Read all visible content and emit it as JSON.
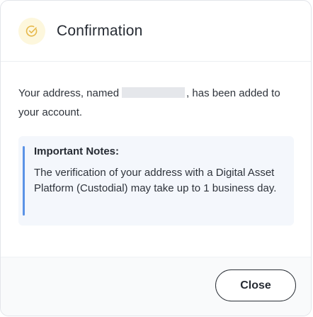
{
  "dialog": {
    "title": "Confirmation",
    "title_icon": "check-circle-icon",
    "accent_color": "#f2c94c"
  },
  "message": {
    "prefix": "Your address, named",
    "address_name_redacted": true,
    "suffix": ", has been added to your account."
  },
  "notes": {
    "title": "Important Notes:",
    "text": "The verification of your address with a Digital Asset Platform (Custodial) may take up to 1 business day.",
    "bar_color": "#5b93e6"
  },
  "footer": {
    "close_label": "Close"
  }
}
